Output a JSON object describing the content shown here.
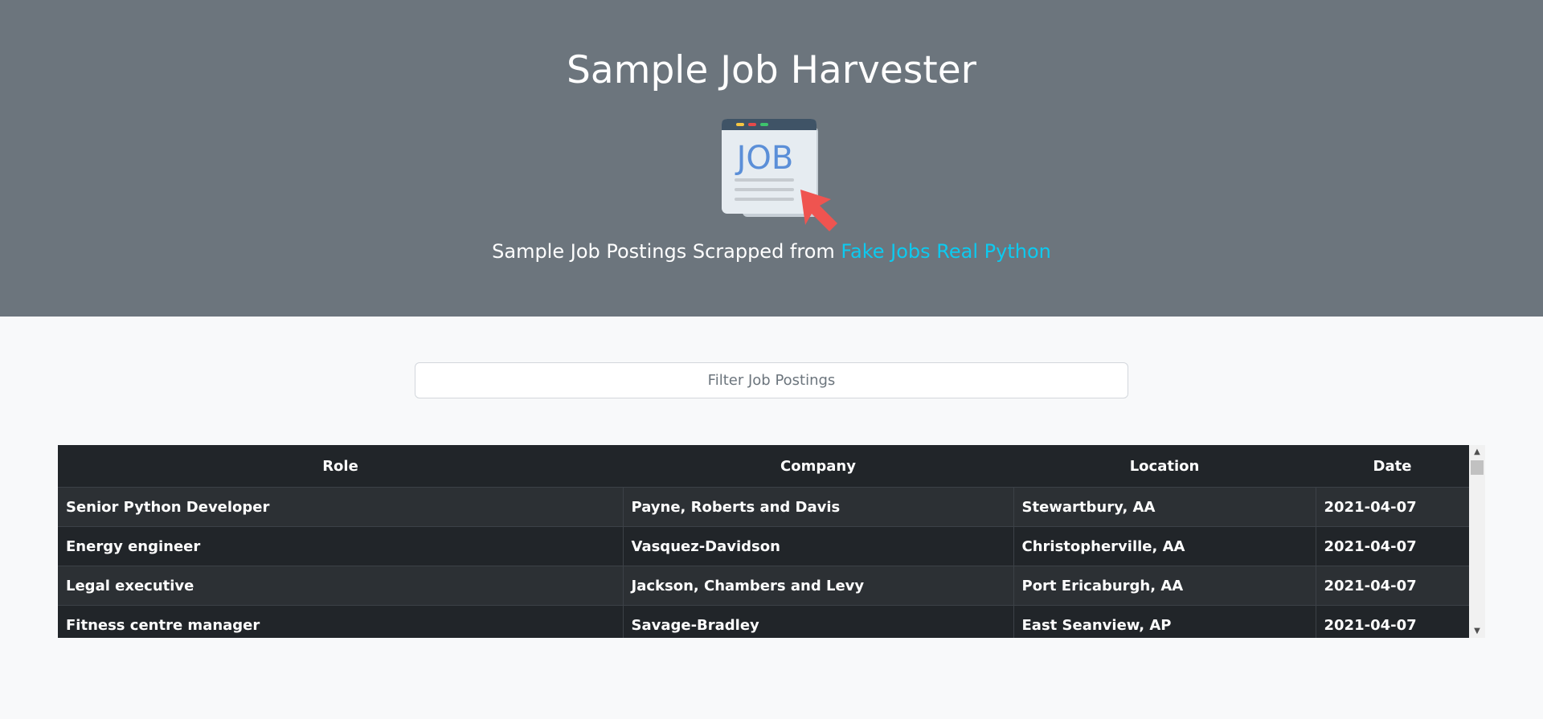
{
  "hero": {
    "title": "Sample Job Harvester",
    "logo_icon": "job-posting-icon",
    "subtitle_prefix": "Sample Job Postings Scrapped from",
    "subtitle_link": "Fake Jobs Real Python",
    "background_color": "#6c757d",
    "link_color": "#0dcaf0"
  },
  "filter": {
    "placeholder": "Filter Job Postings",
    "value": ""
  },
  "table": {
    "columns": [
      "Role",
      "Company",
      "Location",
      "Date"
    ],
    "rows": [
      [
        "Senior Python Developer",
        "Payne, Roberts and Davis",
        "Stewartbury, AA",
        "2021-04-07"
      ],
      [
        "Energy engineer",
        "Vasquez-Davidson",
        "Christopherville, AA",
        "2021-04-07"
      ],
      [
        "Legal executive",
        "Jackson, Chambers and Levy",
        "Port Ericaburgh, AA",
        "2021-04-07"
      ],
      [
        "Fitness centre manager",
        "Savage-Bradley",
        "East Seanview, AP",
        "2021-04-07"
      ]
    ]
  }
}
